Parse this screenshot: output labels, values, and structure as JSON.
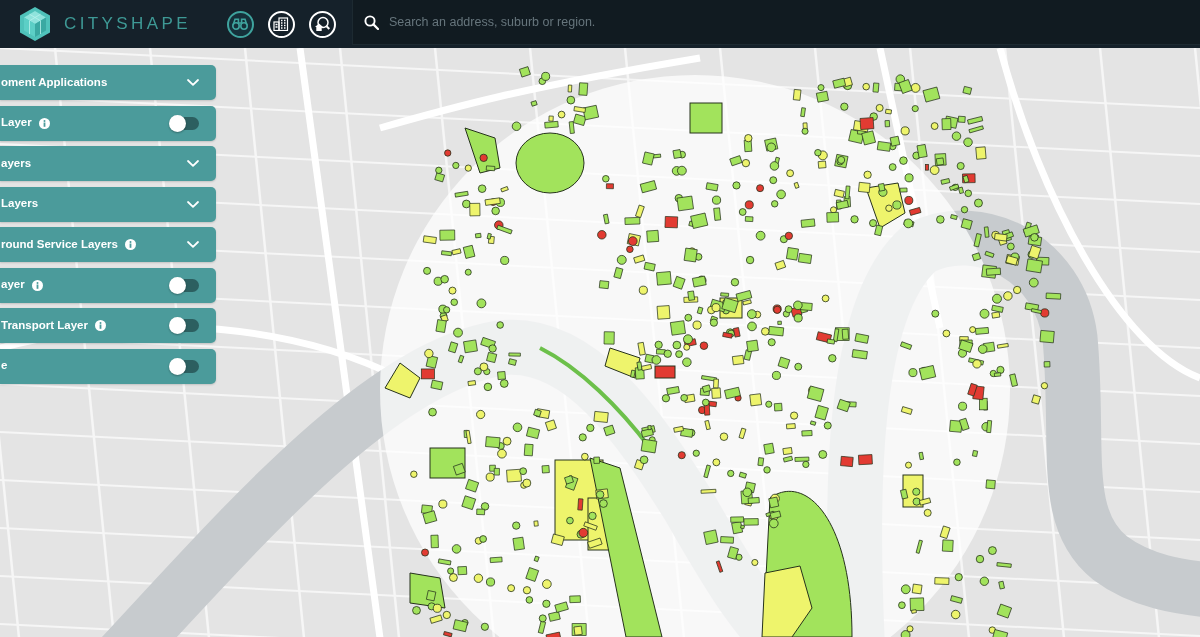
{
  "header": {
    "brand": "CITYSHAPE",
    "nav_buttons": [
      {
        "selected": true
      },
      {
        "selected": false
      },
      {
        "selected": false
      }
    ],
    "search": {
      "placeholder": "Search an address, suburb or region."
    }
  },
  "layer_panel": {
    "items": [
      {
        "label": "oment Applications",
        "kind": "dropdown",
        "info": false,
        "expanded": false
      },
      {
        "label": "Layer",
        "kind": "toggle",
        "info": true,
        "on": false
      },
      {
        "label": "ayers",
        "kind": "dropdown",
        "info": false,
        "expanded": false
      },
      {
        "label": "Layers",
        "kind": "dropdown",
        "info": false,
        "expanded": false
      },
      {
        "label": "round Service Layers",
        "kind": "dropdown",
        "info": true,
        "expanded": false
      },
      {
        "label": "ayer",
        "kind": "toggle",
        "info": true,
        "on": false
      },
      {
        "label": "Transport Layer",
        "kind": "toggle",
        "info": true,
        "on": false
      },
      {
        "label": "e",
        "kind": "toggle",
        "info": false,
        "on": false
      }
    ]
  }
}
